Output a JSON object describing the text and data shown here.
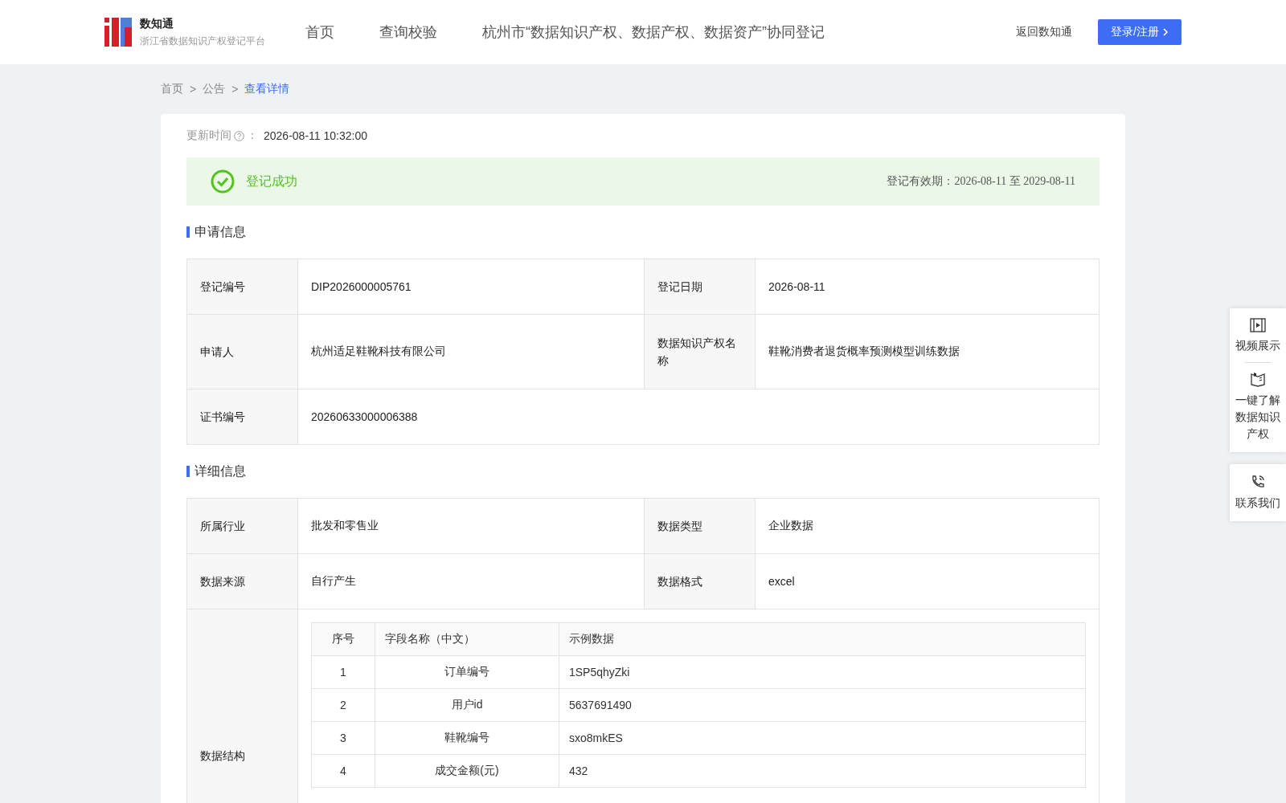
{
  "header": {
    "logo_name": "数知通",
    "logo_subtitle": "浙江省数据知识产权登记平台",
    "nav": [
      {
        "label": "首页",
        "selected": false
      },
      {
        "label": "查询校验",
        "selected": false
      },
      {
        "label": "杭州市“数据知识产权、数据产权、数据资产”协同登记",
        "selected": false
      }
    ],
    "back_link": "返回数知通",
    "login_button": "登录/注册"
  },
  "breadcrumb": [
    {
      "label": "首页",
      "selected": false
    },
    {
      "label": "公告",
      "selected": false
    },
    {
      "label": "查看详情",
      "selected": true
    }
  ],
  "breadcrumb_separator": ">",
  "update_time": {
    "label": "更新时间",
    "separator": "：",
    "value": "2026-08-11 10:32:00"
  },
  "status_banner": {
    "status": "登记成功",
    "validity": "登记有效期：2026-08-11 至 2029-08-11"
  },
  "sections": [
    {
      "title": "申请信息",
      "rows": [
        [
          {
            "label": "登记编号",
            "value": "DIP2026000005761"
          },
          {
            "label": "登记日期",
            "value": "2026-08-11"
          }
        ],
        [
          {
            "label": "申请人",
            "value": "杭州适足鞋靴科技有限公司"
          },
          {
            "label": "数据知识产权名称",
            "value": "鞋靴消费者退货概率预测模型训练数据"
          }
        ],
        [
          {
            "label": "证书编号",
            "value": "20260633000006388"
          }
        ]
      ]
    },
    {
      "title": "详细信息",
      "rows": [
        [
          {
            "label": "所属行业",
            "value": "批发和零售业"
          },
          {
            "label": "数据类型",
            "value": "企业数据"
          }
        ],
        [
          {
            "label": "数据来源",
            "value": "自行产生"
          },
          {
            "label": "数据格式",
            "value": "excel"
          }
        ]
      ],
      "structure": {
        "label": "数据结构",
        "columns": [
          "序号",
          "字段名称（中文）",
          "示例数据"
        ],
        "rows": [
          [
            "1",
            "订单编号",
            "1SP5qhyZki"
          ],
          [
            "2",
            "用户id",
            "5637691490"
          ],
          [
            "3",
            "鞋靴编号",
            "sxo8mkES"
          ],
          [
            "4",
            "成交金额(元)",
            "432"
          ]
        ]
      }
    }
  ],
  "side_tools": [
    {
      "kind": "video",
      "label": "视频展示"
    },
    {
      "kind": "book",
      "label": "一键了解数据知识产权"
    },
    {
      "kind": "phone",
      "label": "联系我们"
    }
  ]
}
